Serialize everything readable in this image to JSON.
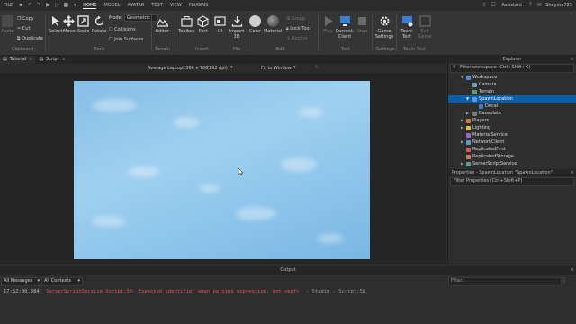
{
  "topbar": {
    "menus": [
      "FILE",
      "HOME",
      "MODEL",
      "AVATAR",
      "TEST",
      "VIEW",
      "PLUGINS"
    ],
    "active_menu": "HOME",
    "assistant_label": "Assistant",
    "user_name": "Shayma725"
  },
  "ribbon": {
    "clipboard": {
      "paste": "Paste",
      "copy": "Copy",
      "cut": "Cut",
      "duplicate": "Duplicate",
      "group_label": "Clipboard"
    },
    "tools": {
      "select": "Select",
      "move": "Move",
      "scale": "Scale",
      "rotate": "Rotate",
      "group_label": "Tools"
    },
    "mode": {
      "label": "Mode:",
      "value": "Geometric",
      "collisions": "Collisions",
      "join_surfaces": "Join Surfaces"
    },
    "terrain": {
      "editor": "Editor",
      "group_label": "Terrain"
    },
    "insert": {
      "toolbox": "Toolbox",
      "part": "Part",
      "ui": "UI",
      "group_label": "Insert"
    },
    "file": {
      "import3d": "Import 3D",
      "group_label": "File"
    },
    "edit": {
      "color": "Color",
      "material": "Material",
      "group": "Group",
      "lock_tool": "Lock Tool",
      "anchor": "Anchor",
      "group_label": "Edit"
    },
    "test": {
      "play": "Play",
      "current_client": "Current: Client",
      "stop": "Stop",
      "group_label": "Test"
    },
    "settings": {
      "game_settings": "Game Settings",
      "group_label": "Settings"
    },
    "team_test": {
      "team_test": "Team Test",
      "exit_game": "Exit Game",
      "group_label": "Team Test"
    }
  },
  "tabs": [
    {
      "label": "Tutorial"
    },
    {
      "label": "Script"
    }
  ],
  "viewport": {
    "device": "Average Laptop",
    "resolution": "1366 x 768",
    "dpi": "(192 dpi)",
    "fit": "Fit to Window"
  },
  "explorer": {
    "title": "Explorer",
    "filter_placeholder": "Filter workspace (Ctrl+Shift+X)",
    "items": [
      {
        "label": "Workspace",
        "color": "#4a8fd8"
      },
      {
        "label": "Camera",
        "color": "#7c9bb5"
      },
      {
        "label": "Terrain",
        "color": "#5aa36a"
      },
      {
        "label": "SpawnLocation",
        "color": "#5aa0e0"
      },
      {
        "label": "Decal",
        "color": "#3f7fcf"
      },
      {
        "label": "Baseplate",
        "color": "#7a7a7a"
      },
      {
        "label": "Players",
        "color": "#d07a3c"
      },
      {
        "label": "Lighting",
        "color": "#e0c040"
      },
      {
        "label": "MaterialService",
        "color": "#9a6ad0"
      },
      {
        "label": "NetworkClient",
        "color": "#5a9ad0"
      },
      {
        "label": "ReplicatedFirst",
        "color": "#d05a5a"
      },
      {
        "label": "ReplicatedStorage",
        "color": "#d07a5a"
      },
      {
        "label": "ServerScriptService",
        "color": "#5aa0a0"
      }
    ]
  },
  "properties": {
    "title": "Properties - SpawnLocation \"SpawnLocation\"",
    "filter_placeholder": "Filter Properties (Ctrl+Shift+P)"
  },
  "output": {
    "title": "Output",
    "messages_filter": "All Messages",
    "contexts_filter": "All Contexts",
    "filter_placeholder": "Filter...",
    "log_time": "17:52:00.384",
    "log_error": "ServerScriptService.Script:58: Expected identifier when parsing expression, got <eof>",
    "log_source": "- Studio - Script:58"
  },
  "colors": {
    "accent": "#0b5ea8",
    "error": "#e05656",
    "sky": "#8cc4ea"
  }
}
